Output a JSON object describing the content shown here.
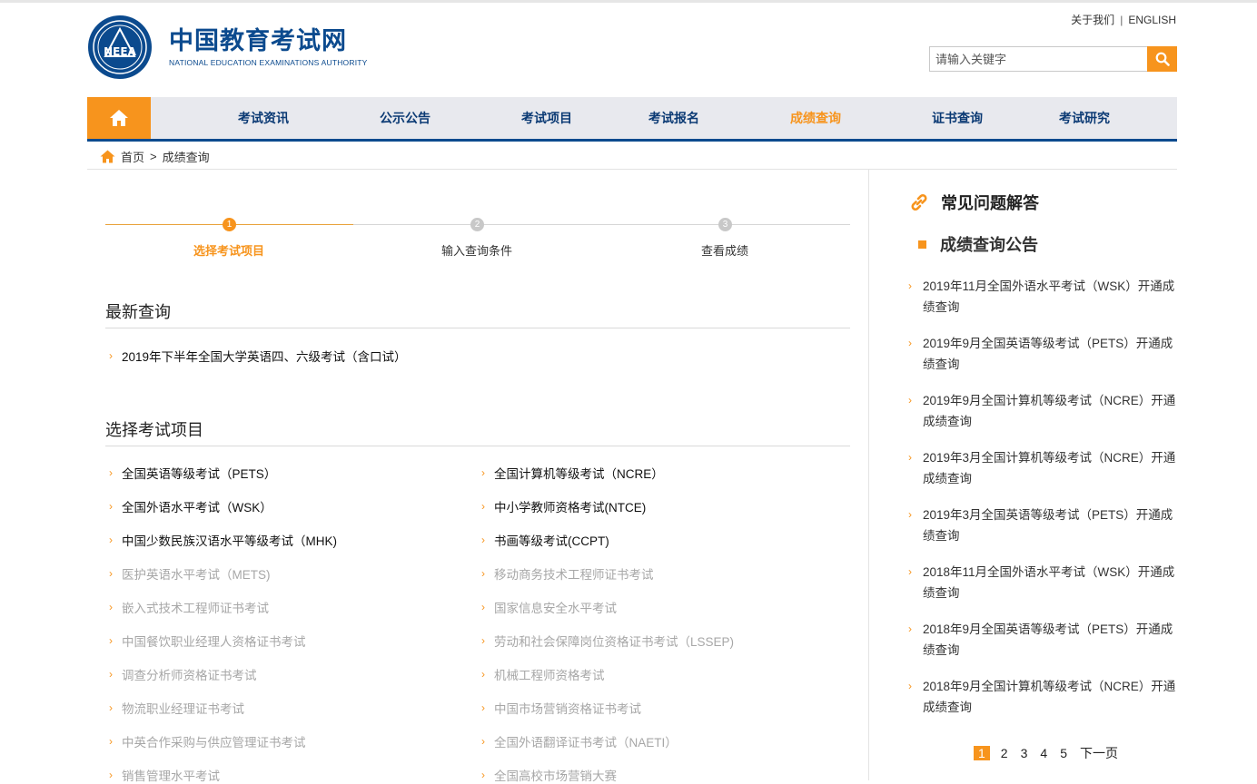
{
  "header": {
    "logo_cn": "中国教育考试网",
    "logo_en": "NATIONAL EDUCATION EXAMINATIONS AUTHORITY",
    "logo_emblem_text": "NEEA",
    "about": "关于我们",
    "divider": "|",
    "english": "ENGLISH",
    "search_placeholder": "请输入关键字"
  },
  "nav": {
    "items": [
      "考试资讯",
      "公示公告",
      "考试项目",
      "考试报名",
      "成绩查询",
      "证书查询",
      "考试研究"
    ],
    "active": "成绩查询"
  },
  "breadcrumb": {
    "home": "首页",
    "sep": ">",
    "current": "成绩查询"
  },
  "steps": [
    {
      "num": "1",
      "label": "选择考试项目",
      "active": true
    },
    {
      "num": "2",
      "label": "输入查询条件",
      "active": false
    },
    {
      "num": "3",
      "label": "查看成绩",
      "active": false
    }
  ],
  "latest": {
    "title": "最新查询",
    "items": [
      "2019年下半年全国大学英语四、六级考试（含口试）"
    ]
  },
  "projects": {
    "title": "选择考试项目",
    "left": [
      {
        "label": "全国英语等级考试（PETS）",
        "enabled": true
      },
      {
        "label": "全国外语水平考试（WSK）",
        "enabled": true
      },
      {
        "label": "中国少数民族汉语水平等级考试（MHK)",
        "enabled": true
      },
      {
        "label": "医护英语水平考试（METS)",
        "enabled": false
      },
      {
        "label": "嵌入式技术工程师证书考试",
        "enabled": false
      },
      {
        "label": "中国餐饮职业经理人资格证书考试",
        "enabled": false
      },
      {
        "label": "调查分析师资格证书考试",
        "enabled": false
      },
      {
        "label": "物流职业经理证书考试",
        "enabled": false
      },
      {
        "label": "中英合作采购与供应管理证书考试",
        "enabled": false
      },
      {
        "label": "销售管理水平考试",
        "enabled": false
      }
    ],
    "right": [
      {
        "label": "全国计算机等级考试（NCRE）",
        "enabled": true
      },
      {
        "label": "中小学教师资格考试(NTCE)",
        "enabled": true
      },
      {
        "label": "书画等级考试(CCPT)",
        "enabled": true
      },
      {
        "label": "移动商务技术工程师证书考试",
        "enabled": false
      },
      {
        "label": "国家信息安全水平考试",
        "enabled": false
      },
      {
        "label": "劳动和社会保障岗位资格证书考试（LSSEP)",
        "enabled": false
      },
      {
        "label": "机械工程师资格考试",
        "enabled": false
      },
      {
        "label": "中国市场营销资格证书考试",
        "enabled": false
      },
      {
        "label": "全国外语翻译证书考试（NAETI）",
        "enabled": false
      },
      {
        "label": "全国高校市场营销大赛",
        "enabled": false
      }
    ]
  },
  "sidebar": {
    "faq_title": "常见问题解答",
    "announce_title": "成绩查询公告",
    "items": [
      "2019年11月全国外语水平考试（WSK）开通成绩查询",
      "2019年9月全国英语等级考试（PETS）开通成绩查询",
      "2019年9月全国计算机等级考试（NCRE）开通成绩查询",
      "2019年3月全国计算机等级考试（NCRE）开通成绩查询",
      "2019年3月全国英语等级考试（PETS）开通成绩查询",
      "2018年11月全国外语水平考试（WSK）开通成绩查询",
      "2018年9月全国英语等级考试（PETS）开通成绩查询",
      "2018年9月全国计算机等级考试（NCRE）开通成绩查询"
    ],
    "pager": {
      "pages": [
        "1",
        "2",
        "3",
        "4",
        "5"
      ],
      "current": "1",
      "next": "下一页"
    }
  },
  "colors": {
    "brand_blue": "#0b4a8e",
    "accent_orange": "#f7941d",
    "nav_bg": "#e8e9ee",
    "disabled_text": "#a7a7a7"
  },
  "icons": {
    "home": "home-icon",
    "search": "search-icon",
    "link": "link-icon",
    "arrow": "chevron-right-icon"
  }
}
